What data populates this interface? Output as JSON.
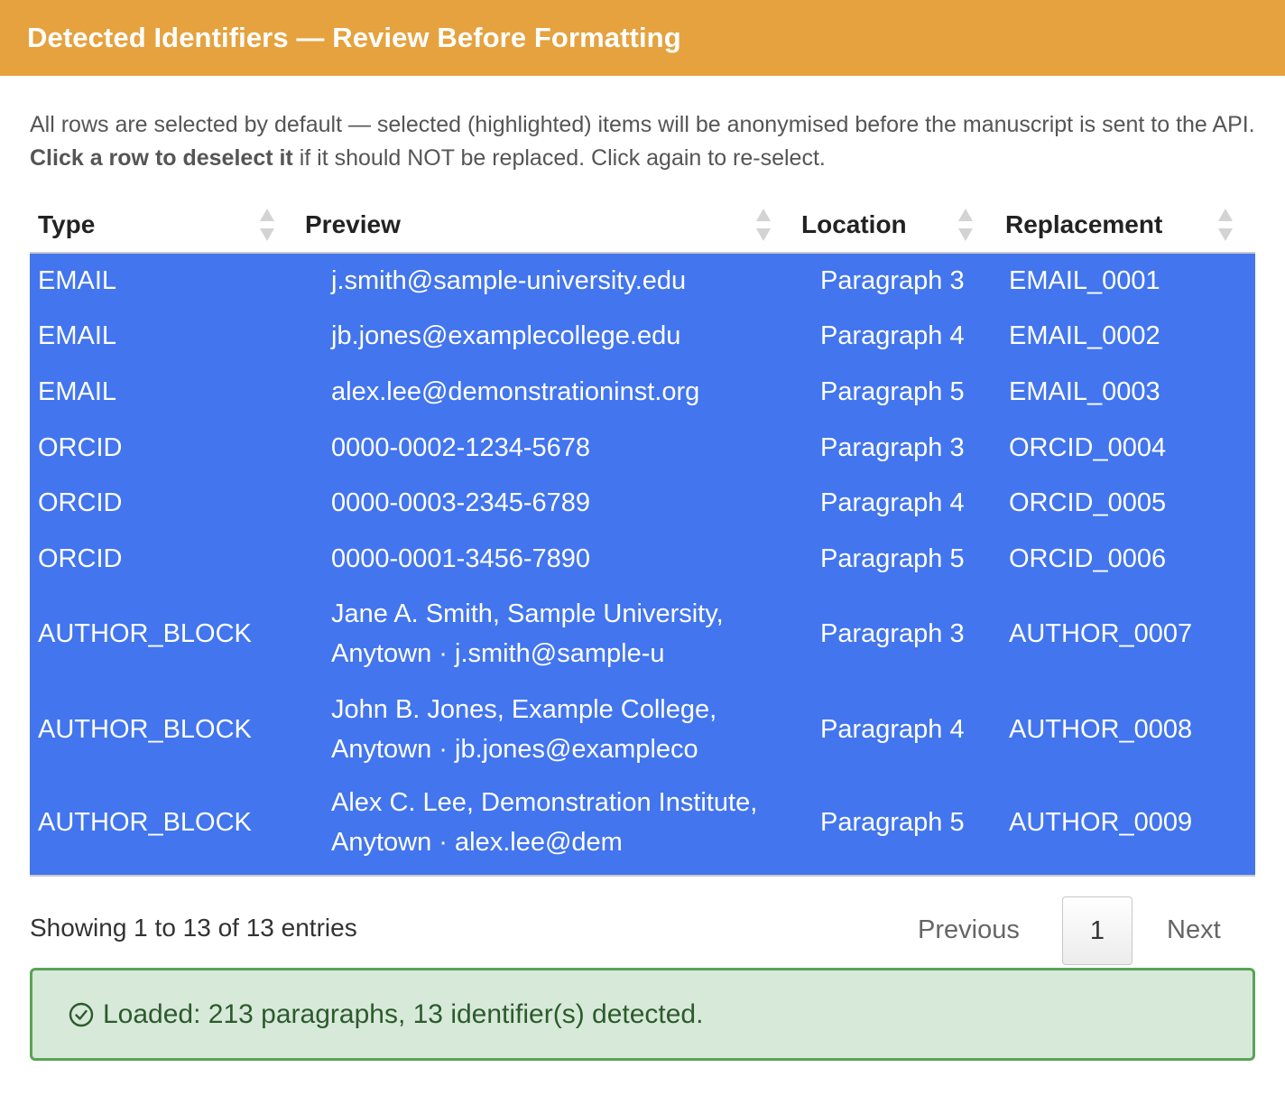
{
  "header": {
    "title": "Detected Identifiers — Review Before Formatting"
  },
  "intro": {
    "part1": "All rows are selected by default — selected (highlighted) items will be anonymised before the manuscript is sent to the API. ",
    "bold": "Click a row to deselect it",
    "part2": " if it should NOT be replaced. Click again to re-select."
  },
  "table": {
    "columns": [
      "Type",
      "Preview",
      "Location",
      "Replacement"
    ],
    "rows": [
      {
        "type": "EMAIL",
        "preview": "j.smith@sample-university.edu",
        "location": "Paragraph 3",
        "replacement": "EMAIL_0001"
      },
      {
        "type": "EMAIL",
        "preview": "jb.jones@examplecollege.edu",
        "location": "Paragraph 4",
        "replacement": "EMAIL_0002"
      },
      {
        "type": "EMAIL",
        "preview": "alex.lee@demonstrationinst.org",
        "location": "Paragraph 5",
        "replacement": "EMAIL_0003"
      },
      {
        "type": "ORCID",
        "preview": "0000-0002-1234-5678",
        "location": "Paragraph 3",
        "replacement": "ORCID_0004"
      },
      {
        "type": "ORCID",
        "preview": "0000-0003-2345-6789",
        "location": "Paragraph 4",
        "replacement": "ORCID_0005"
      },
      {
        "type": "ORCID",
        "preview": "0000-0001-3456-7890",
        "location": "Paragraph 5",
        "replacement": "ORCID_0006"
      },
      {
        "type": "AUTHOR_BLOCK",
        "preview": "Jane A. Smith, Sample University, Anytown · j.smith@sample-u",
        "location": "Paragraph 3",
        "replacement": "AUTHOR_0007"
      },
      {
        "type": "AUTHOR_BLOCK",
        "preview": "John B. Jones, Example College, Anytown · jb.jones@exampleco",
        "location": "Paragraph 4",
        "replacement": "AUTHOR_0008"
      },
      {
        "type": "AUTHOR_BLOCK",
        "preview": "Alex C. Lee, Demonstration Institute, Anytown · alex.lee@dem",
        "location": "Paragraph 5",
        "replacement": "AUTHOR_0009"
      }
    ]
  },
  "footer": {
    "info": "Showing 1 to 13 of 13 entries",
    "previous": "Previous",
    "page": "1",
    "next": "Next"
  },
  "alert": {
    "icon": "check-circle-icon",
    "text": "Loaded: 213 paragraphs, 13 identifier(s) detected."
  },
  "colors": {
    "header_bg": "#e5a23f",
    "selected_row": "#4275ee",
    "alert_bg": "#d7e9d9",
    "alert_border": "#5aa357"
  }
}
